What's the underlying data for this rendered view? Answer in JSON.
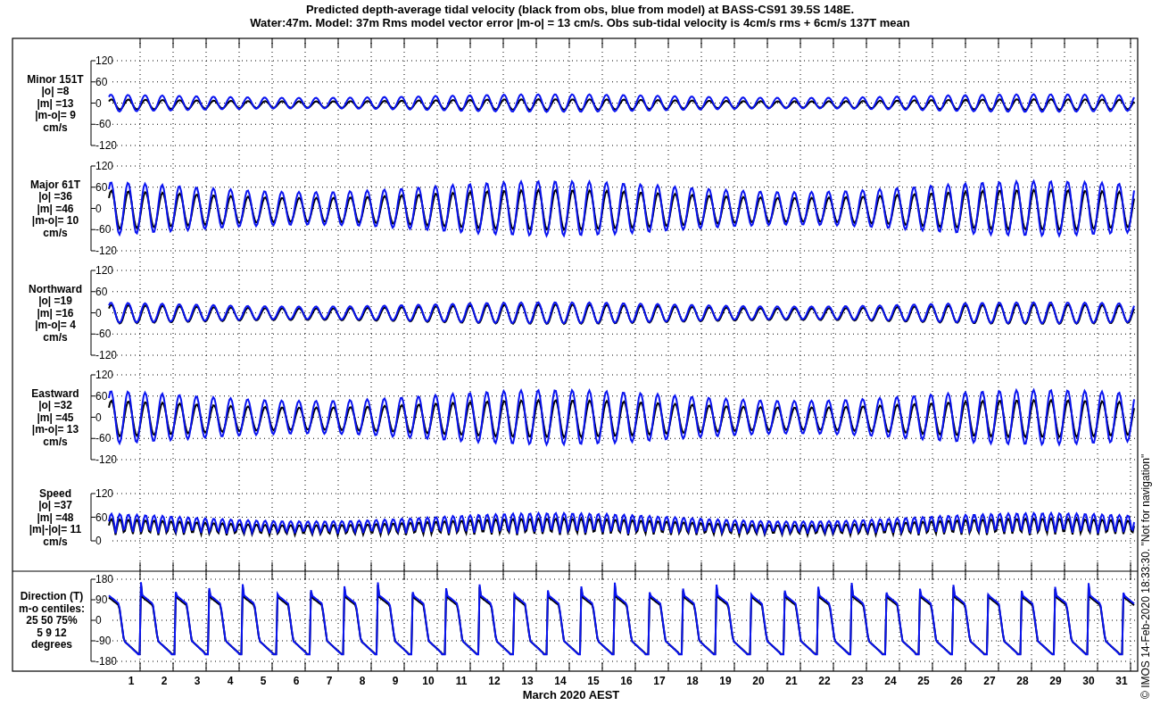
{
  "title_lines": [
    "Predicted depth-average tidal velocity (black from obs, blue from model) at BASS-CS91 39.5S 148E.",
    "Water:47m. Model: 37m  Rms model vector error |m-o| = 13 cm/s. Obs sub-tidal velocity is 4cm/s rms + 6cm/s 137T mean"
  ],
  "panels": [
    {
      "kind": "signed",
      "label_lines": [
        "Minor 151T",
        "|o| =8",
        "|m| =13",
        "|m-o|= 9",
        "cm/s"
      ],
      "y_ticks": [
        "120",
        "60",
        "0",
        "-60",
        "-120"
      ]
    },
    {
      "kind": "signed",
      "label_lines": [
        "Major 61T",
        "|o| =36",
        "|m| =46",
        "|m-o|= 10",
        "cm/s"
      ],
      "y_ticks": [
        "120",
        "60",
        "0",
        "-60",
        "-120"
      ]
    },
    {
      "kind": "signed",
      "label_lines": [
        "Northward",
        "|o| =19",
        "|m| =16",
        "|m-o|= 4",
        "cm/s"
      ],
      "y_ticks": [
        "120",
        "60",
        "0",
        "-60",
        "-120"
      ]
    },
    {
      "kind": "signed",
      "label_lines": [
        "Eastward",
        "|o| =32",
        "|m| =45",
        "|m-o|= 13",
        "cm/s"
      ],
      "y_ticks": [
        "120",
        "60",
        "0",
        "-60",
        "-120"
      ]
    },
    {
      "kind": "speed",
      "label_lines": [
        "Speed",
        "|o| =37",
        "|m| =48",
        "|m|-|o|= 11",
        "cm/s"
      ],
      "y_ticks": [
        "120",
        "60",
        "0"
      ]
    },
    {
      "kind": "direction",
      "label_lines": [
        "Direction (T)",
        "m-o centiles:",
        "25  50  75%",
        "5   9  12",
        "degrees"
      ],
      "y_ticks": [
        "180",
        "90",
        "0",
        "-90",
        "-180"
      ]
    }
  ],
  "x_axis": {
    "ticks": [
      "1",
      "2",
      "3",
      "4",
      "5",
      "6",
      "7",
      "8",
      "9",
      "10",
      "11",
      "12",
      "13",
      "14",
      "15",
      "16",
      "17",
      "18",
      "19",
      "20",
      "21",
      "22",
      "23",
      "24",
      "25",
      "26",
      "27",
      "28",
      "29",
      "30",
      "31"
    ],
    "label": "March 2020 AEST"
  },
  "footer_note": "© IMOS 14-Feb-2020 18:33:30.  \"Not for navigation\""
}
